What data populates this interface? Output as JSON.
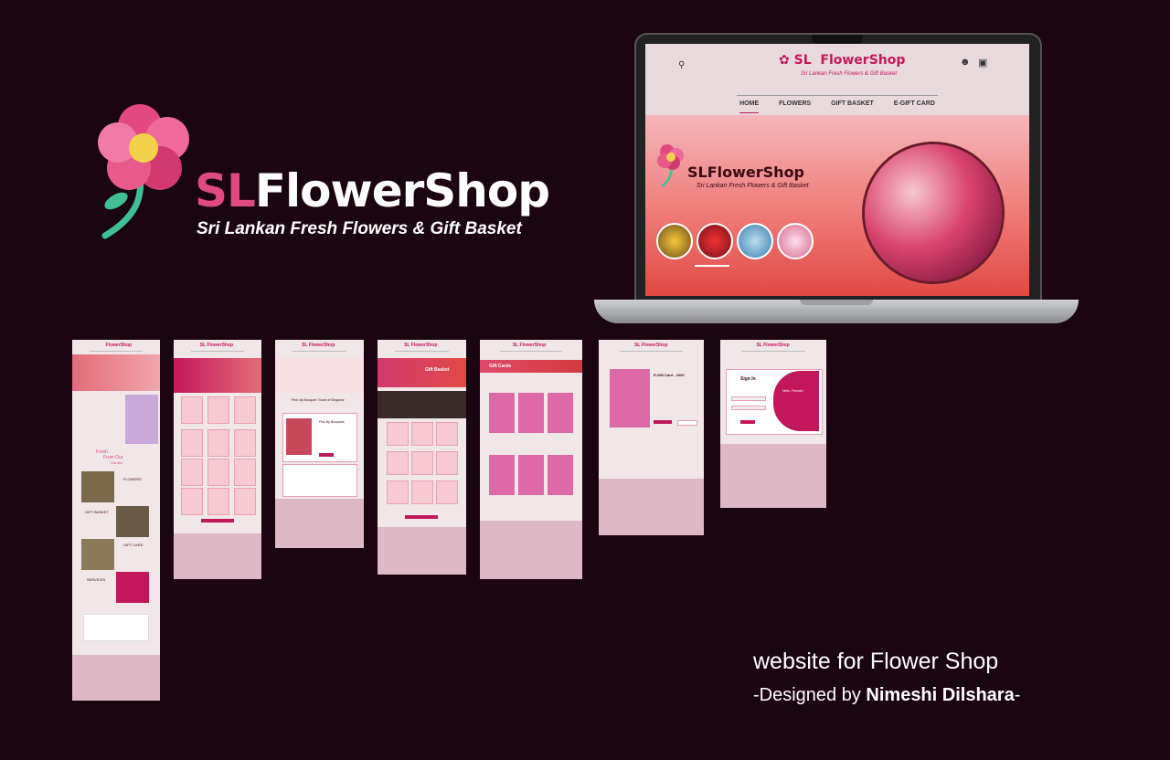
{
  "brand": {
    "sl": "SL",
    "name": "FlowerShop",
    "tagline": "Sri Lankan Fresh Flowers & Gift Basket"
  },
  "laptop_site": {
    "logo_sl": "SL",
    "logo_name": "FlowerShop",
    "logo_sub": "Sri Lankan Fresh Flowers & Gift Basket",
    "nav": [
      "HOME",
      "FLOWERS",
      "GIFT BASKET",
      "E-GIFT CARD"
    ],
    "hero_title": "SLFlowerShop",
    "hero_sub": "Sri Lankan Fresh Flowers & Gift Basket",
    "icons": {
      "search": "search-icon",
      "user": "user-icon",
      "cart": "cart-icon"
    }
  },
  "pages": {
    "home": {
      "logo": "FlowerShop",
      "fresh": "Fresh",
      "from": "From Our",
      "garden": "Garden",
      "flowers": "FLOWERS",
      "gift_basket": "GIFT BASKET",
      "gift_card": "GIFT CARD",
      "services": "SERVICES"
    },
    "flowers": {
      "logo": "SL FlowerShop"
    },
    "product": {
      "logo": "SL FlowerShop",
      "title": "Pink Lily Bouquet: Touch of Elegance",
      "name": "Pink lily Bouquets"
    },
    "gift_basket": {
      "logo": "SL FlowerShop",
      "title": "Gift Basket"
    },
    "gift_cards": {
      "logo": "SL FlowerShop",
      "title": "Gift Cards"
    },
    "egift": {
      "logo": "SL FlowerShop",
      "title": "E-Gift Card - 2000"
    },
    "signin": {
      "logo": "SL FlowerShop",
      "title": "Sign In",
      "hello": "Hello, Friends!"
    }
  },
  "credit": {
    "line1": "website for Flower Shop",
    "prefix": "-Designed by ",
    "author": "Nimeshi Dilshara",
    "suffix": "-"
  },
  "colors": {
    "bg": "#1a0510",
    "accent": "#e2497f",
    "brand": "#c2185b"
  }
}
